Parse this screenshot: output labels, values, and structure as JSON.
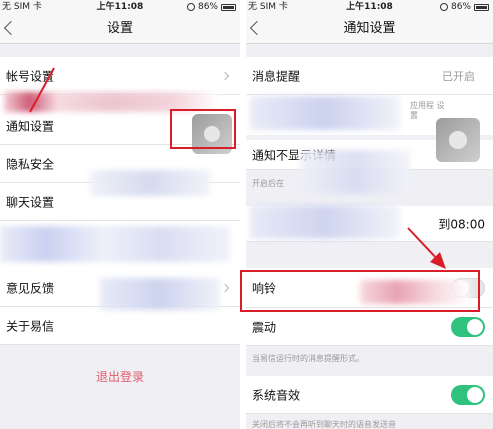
{
  "status": {
    "carrier": "无 SIM 卡",
    "time": "上午11:08",
    "battery": "86%",
    "battery_level": 0.86
  },
  "left": {
    "title": "设置",
    "items": [
      {
        "label": "帐号设置"
      },
      {
        "label": "通知设置"
      },
      {
        "label": "隐私安全"
      },
      {
        "label": "聊天设置"
      },
      {
        "label": "意见反馈"
      },
      {
        "label": "关于易信"
      }
    ],
    "logout": "退出登录"
  },
  "right": {
    "title": "通知设置",
    "message_alert": {
      "label": "消息提醒",
      "value": "已开启"
    },
    "hidden_note": "应用程 设置",
    "no_detail": {
      "label": "通知不显示详情"
    },
    "no_detail_note": "开启后在",
    "time_range": "到08:00",
    "ringtone": {
      "label": "响铃",
      "on": false
    },
    "vibrate": {
      "label": "震动",
      "on": true
    },
    "vibrate_note": "当易信运行时的消息提醒形式。",
    "system_sound": {
      "label": "系统音效",
      "on": true
    },
    "system_sound_note": "关闭后将不会再听到聊天时的语音发送音"
  },
  "colors": {
    "accent_green": "#2ec27e",
    "highlight_red": "#d91e2a",
    "logout_pink": "#e15b6b"
  }
}
